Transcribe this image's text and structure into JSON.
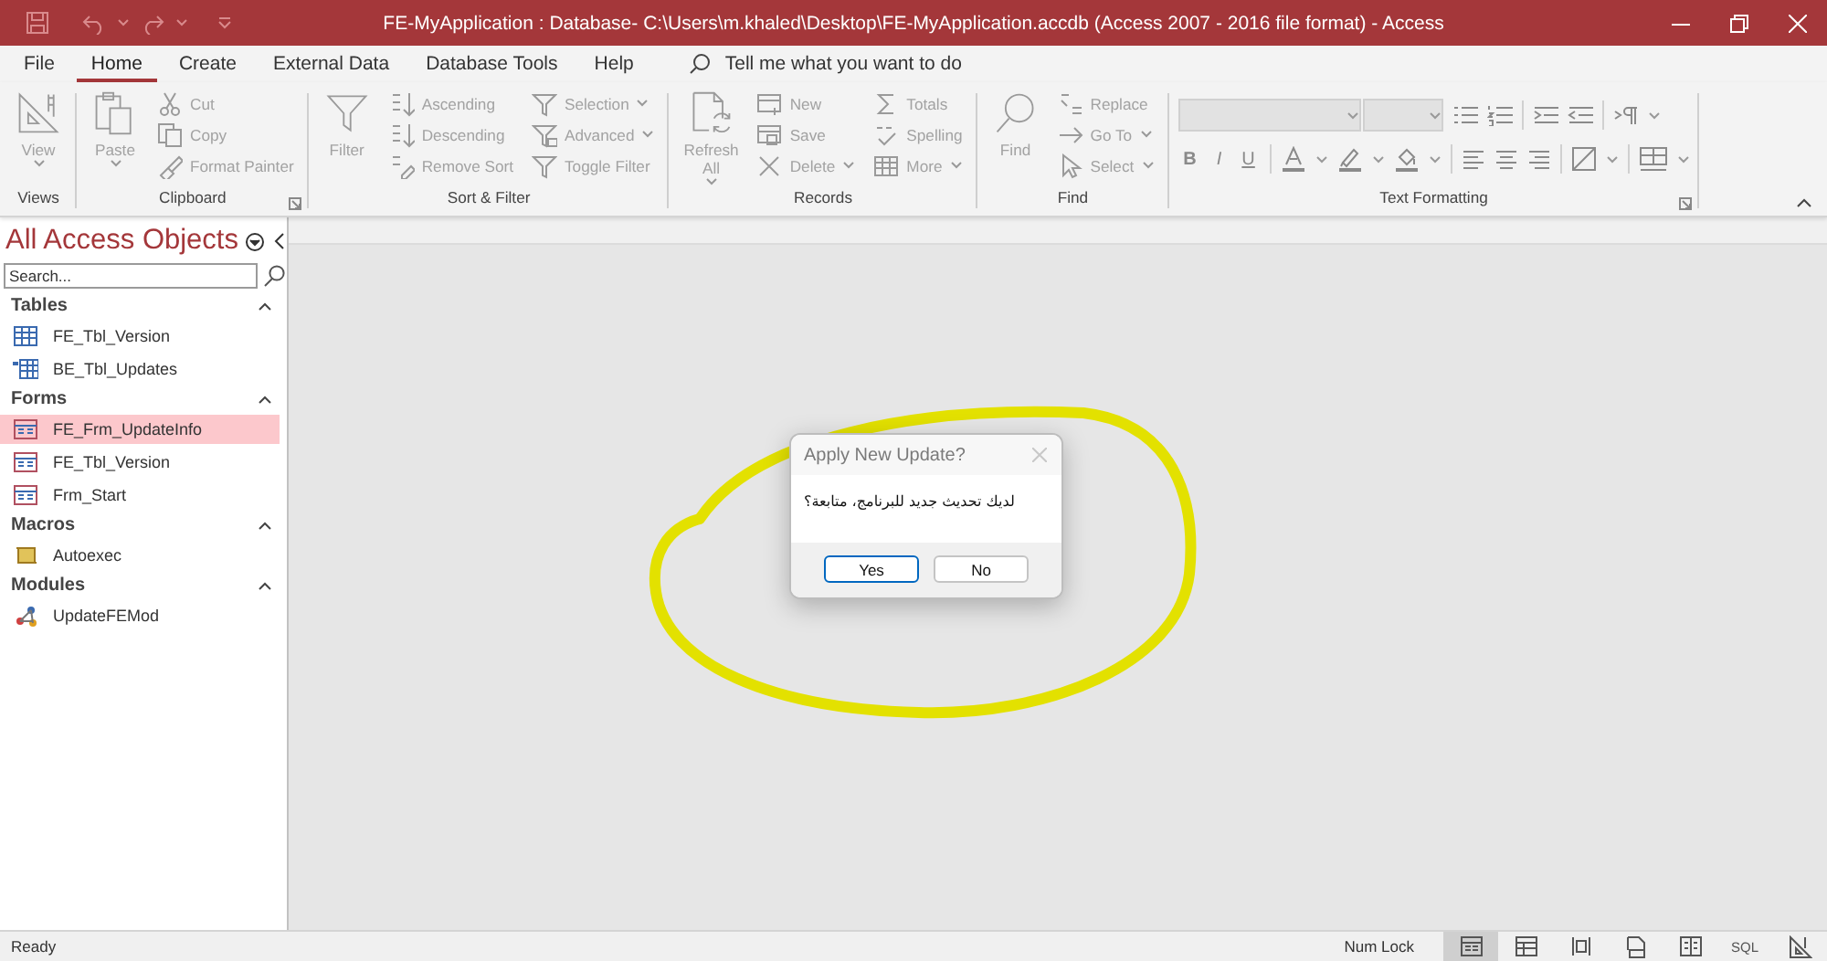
{
  "window": {
    "title": "FE-MyApplication : Database- C:\\Users\\m.khaled\\Desktop\\FE-MyApplication.accdb (Access 2007 - 2016 file format)  -  Access"
  },
  "ribbon_tabs": [
    {
      "label": "File",
      "selected": false
    },
    {
      "label": "Home",
      "selected": true
    },
    {
      "label": "Create",
      "selected": false
    },
    {
      "label": "External Data",
      "selected": false
    },
    {
      "label": "Database Tools",
      "selected": false
    },
    {
      "label": "Help",
      "selected": false
    }
  ],
  "tell_me": {
    "placeholder": "Tell me what you want to do"
  },
  "ribbon_groups": [
    {
      "kind": "commands",
      "label": "Views",
      "launcher": false,
      "large": {
        "lines": [
          "View"
        ],
        "dropdown": true,
        "disabled": true
      }
    },
    {
      "kind": "commands",
      "label": "Clipboard",
      "launcher": true,
      "large": {
        "lines": [
          "Paste"
        ],
        "dropdown": true,
        "disabled": true
      },
      "columns": [
        [
          {
            "label": "Cut",
            "dropdown": false,
            "disabled": true
          },
          {
            "label": "Copy",
            "dropdown": false,
            "disabled": true
          },
          {
            "label": "Format Painter",
            "dropdown": false,
            "disabled": true
          }
        ]
      ]
    },
    {
      "kind": "commands",
      "label": "Sort & Filter",
      "launcher": false,
      "large": {
        "lines": [
          "Filter"
        ],
        "dropdown": false,
        "disabled": true
      },
      "columns": [
        [
          {
            "label": "Ascending",
            "dropdown": false,
            "disabled": true
          },
          {
            "label": "Descending",
            "dropdown": false,
            "disabled": true
          },
          {
            "label": "Remove Sort",
            "dropdown": false,
            "disabled": true
          }
        ],
        [
          {
            "label": "Selection",
            "dropdown": true,
            "disabled": true
          },
          {
            "label": "Advanced",
            "dropdown": true,
            "disabled": true
          },
          {
            "label": "Toggle Filter",
            "dropdown": false,
            "disabled": true
          }
        ]
      ]
    },
    {
      "kind": "commands",
      "label": "Records",
      "launcher": false,
      "large": {
        "lines": [
          "Refresh",
          "All"
        ],
        "dropdown": true,
        "disabled": true
      },
      "columns": [
        [
          {
            "label": "New",
            "dropdown": false,
            "disabled": true
          },
          {
            "label": "Save",
            "dropdown": false,
            "disabled": true
          },
          {
            "label": "Delete",
            "dropdown": true,
            "disabled": true
          }
        ],
        [
          {
            "label": "Totals",
            "dropdown": false,
            "disabled": true
          },
          {
            "label": "Spelling",
            "dropdown": false,
            "disabled": true
          },
          {
            "label": "More",
            "dropdown": true,
            "disabled": true
          }
        ]
      ]
    },
    {
      "kind": "commands",
      "label": "Find",
      "launcher": false,
      "large": {
        "lines": [
          "Find"
        ],
        "dropdown": false,
        "disabled": true
      },
      "columns": [
        [
          {
            "label": "Replace",
            "dropdown": false,
            "disabled": true
          },
          {
            "label": "Go To",
            "dropdown": true,
            "disabled": true
          },
          {
            "label": "Select",
            "dropdown": true,
            "disabled": true
          }
        ]
      ]
    },
    {
      "kind": "formatting",
      "label": "Text Formatting",
      "launcher": true,
      "letters": [
        "B",
        "I",
        "U"
      ]
    }
  ],
  "nav": {
    "title": "All Access Objects",
    "search": {
      "placeholder": "Search..."
    },
    "sections": [
      {
        "label": "Tables",
        "expanded": true,
        "items": [
          {
            "label": "FE_Tbl_Version",
            "kind": "table",
            "selected": false
          },
          {
            "label": "BE_Tbl_Updates",
            "kind": "linked-table",
            "selected": false
          }
        ]
      },
      {
        "label": "Forms",
        "expanded": true,
        "items": [
          {
            "label": "FE_Frm_UpdateInfo",
            "kind": "form",
            "selected": true
          },
          {
            "label": "FE_Tbl_Version",
            "kind": "form",
            "selected": false
          },
          {
            "label": "Frm_Start",
            "kind": "form",
            "selected": false
          }
        ]
      },
      {
        "label": "Macros",
        "expanded": true,
        "items": [
          {
            "label": "Autoexec",
            "kind": "macro",
            "selected": false
          }
        ]
      },
      {
        "label": "Modules",
        "expanded": true,
        "items": [
          {
            "label": "UpdateFEMod",
            "kind": "module",
            "selected": false
          }
        ]
      }
    ]
  },
  "dialog": {
    "title": "Apply New Update?",
    "message": "لديك تحديث جديد للبرنامج، متابعة؟",
    "buttons": [
      {
        "label": "Yes",
        "focused": true
      },
      {
        "label": "No",
        "focused": false
      }
    ]
  },
  "status_bar": {
    "text": "Ready",
    "indicator": "Num Lock",
    "views": [
      {
        "kind": "form",
        "selected": true
      },
      {
        "kind": "datasheet",
        "selected": false
      },
      {
        "kind": "layout",
        "selected": false
      },
      {
        "kind": "print",
        "selected": false
      },
      {
        "kind": "split",
        "selected": false
      },
      {
        "kind": "sql",
        "label": "SQL",
        "selected": false
      },
      {
        "kind": "design",
        "selected": false
      }
    ]
  }
}
